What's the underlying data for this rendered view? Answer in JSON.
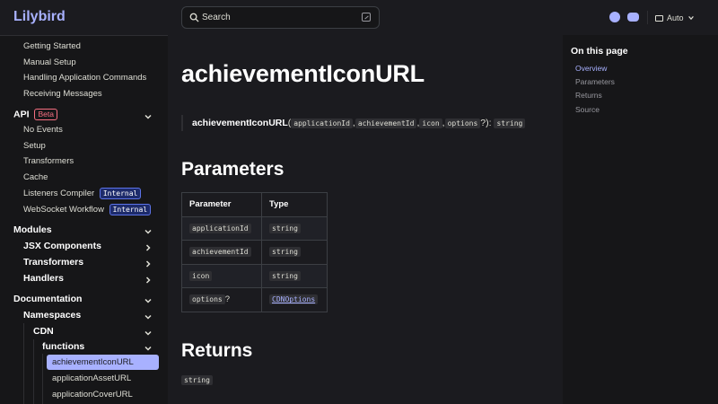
{
  "header": {
    "logo": "Lilybird",
    "search_label": "Search",
    "theme_label": "Auto"
  },
  "sidebar": {
    "top_items": [
      "Getting Started",
      "Manual Setup",
      "Handling Application Commands",
      "Receiving Messages"
    ],
    "api": {
      "label": "API",
      "badge": "Beta",
      "items": [
        "No Events",
        "Setup",
        "Transformers",
        "Cache",
        "Listeners Compiler",
        "WebSocket Workflow"
      ],
      "internal_badge": "Internal"
    },
    "modules": {
      "label": "Modules",
      "groups": [
        "JSX Components",
        "Transformers",
        "Handlers"
      ]
    },
    "documentation": {
      "label": "Documentation",
      "namespaces": "Namespaces",
      "cdn": "CDN",
      "functions": "functions",
      "function_items": [
        "achievementIconURL",
        "applicationAssetURL",
        "applicationCoverURL"
      ]
    }
  },
  "main": {
    "title": "achievementIconURL",
    "signature": {
      "name": "achievementIconURL",
      "params": [
        "applicationId",
        "achievementId",
        "icon",
        "options"
      ],
      "returns": "string"
    },
    "parameters_heading": "Parameters",
    "table": {
      "headers": [
        "Parameter",
        "Type"
      ],
      "rows": [
        {
          "param": "applicationId",
          "optional": "",
          "type": "string",
          "link": false
        },
        {
          "param": "achievementId",
          "optional": "",
          "type": "string",
          "link": false
        },
        {
          "param": "icon",
          "optional": "",
          "type": "string",
          "link": false
        },
        {
          "param": "options",
          "optional": "?",
          "type": "CDNOptions",
          "link": true
        }
      ]
    },
    "returns_heading": "Returns",
    "returns_type": "string"
  },
  "aside": {
    "title": "On this page",
    "items": [
      "Overview",
      "Parameters",
      "Returns",
      "Source"
    ],
    "active_index": 0
  },
  "colors": {
    "accent": "#a8b1ff",
    "background": "#1b1b1f",
    "sidebar_bg": "#161618",
    "beta_badge": "#f66f81",
    "internal_badge_bg": "#1d2b6b"
  }
}
